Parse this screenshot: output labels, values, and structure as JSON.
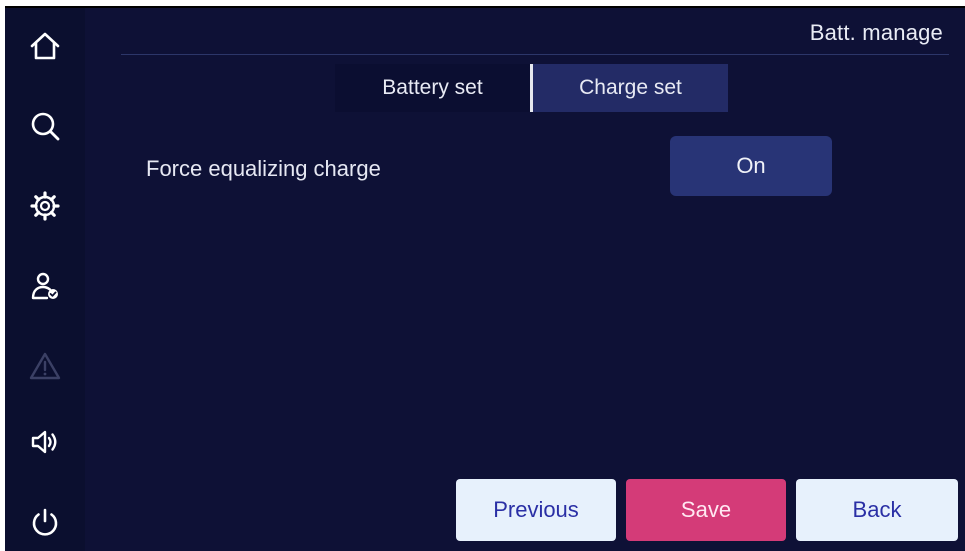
{
  "header": {
    "title": "Batt. manage"
  },
  "sidebar": {
    "items": [
      {
        "name": "home",
        "icon": "home-icon",
        "enabled": true
      },
      {
        "name": "search",
        "icon": "search-icon",
        "enabled": true
      },
      {
        "name": "settings",
        "icon": "gear-icon",
        "enabled": true
      },
      {
        "name": "user",
        "icon": "user-check-icon",
        "enabled": true
      },
      {
        "name": "alarm",
        "icon": "warning-icon",
        "enabled": false
      },
      {
        "name": "sound",
        "icon": "speaker-icon",
        "enabled": true
      },
      {
        "name": "power",
        "icon": "power-icon",
        "enabled": true
      }
    ]
  },
  "tabs": [
    {
      "label": "Battery set",
      "active": false
    },
    {
      "label": "Charge set",
      "active": true
    }
  ],
  "settings": {
    "force_equalizing_charge": {
      "label": "Force equalizing charge",
      "value": "On"
    }
  },
  "footer": {
    "previous_label": "Previous",
    "save_label": "Save",
    "back_label": "Back"
  },
  "colors": {
    "background": "#0e1136",
    "sidebar": "#0b0f2f",
    "active_tab": "#232b66",
    "toggle": "#283476",
    "save_button": "#d43b78",
    "light_button": "#e7f1fc",
    "light_button_text": "#2a2fa5"
  }
}
